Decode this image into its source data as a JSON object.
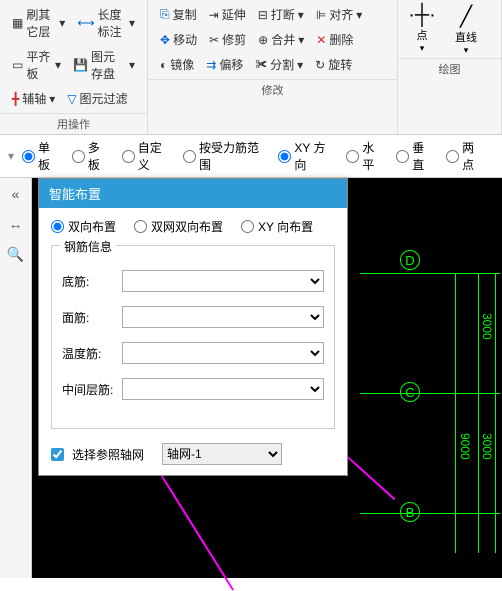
{
  "ribbon": {
    "row1": {
      "other_layers": "刷其它层",
      "length_dim": "长度标注",
      "copy": "复制",
      "extend": "延伸",
      "break": "打断",
      "align": "对齐"
    },
    "row2": {
      "flat_panel": "平齐板",
      "yuan_store": "图元存盘",
      "move": "移动",
      "trim": "修剪",
      "merge": "合并",
      "delete": "删除"
    },
    "row3": {
      "axis_tool": "辅轴",
      "yuan_filter": "图元过滤",
      "mirror": "镜像",
      "offset": "偏移",
      "split": "分割",
      "rotate": "旋转"
    },
    "group_labels": {
      "operation": "用操作",
      "modify": "修改",
      "draw": "绘图"
    },
    "draw": {
      "point": "点",
      "line": "直线"
    }
  },
  "radio_bar": {
    "single": "单板",
    "multi": "多板",
    "custom": "自定义",
    "by_force": "按受力筋范围",
    "xy": "XY 方向",
    "horiz": "水平",
    "vert": "垂直",
    "two_pt": "两点"
  },
  "dialog": {
    "title": "智能布置",
    "opt1": "双向布置",
    "opt2": "双网双向布置",
    "opt3": "XY 向布置",
    "fieldset": "钢筋信息",
    "bottom": "底筋:",
    "top": "面筋:",
    "temp": "温度筋:",
    "middle": "中间层筋:",
    "check": "选择参照轴网",
    "axis_sel": "轴网-1"
  },
  "canvas": {
    "label_d": "D",
    "label_c": "C",
    "label_b": "B",
    "dim_3000_1": "3000",
    "dim_3000_2": "3000",
    "dim_9000": "9000"
  }
}
